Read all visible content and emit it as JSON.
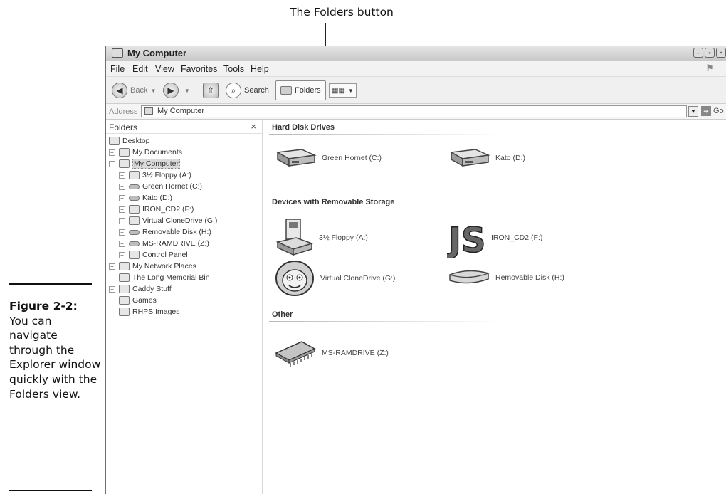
{
  "callout": {
    "text": "The Folders button"
  },
  "caption": {
    "label": "Figure 2-2:",
    "text": "You can navigate through the Explorer window quickly with the Folders view."
  },
  "window": {
    "title": "My Computer",
    "menu": [
      "File",
      "Edit",
      "View",
      "Favorites",
      "Tools",
      "Help"
    ],
    "toolbar": {
      "back_label": "Back",
      "search_label": "Search",
      "folders_label": "Folders"
    },
    "address": {
      "label": "Address",
      "value": "My Computer",
      "go_label": "Go"
    },
    "folders_pane": {
      "title": "Folders",
      "close": "×",
      "tree": [
        {
          "label": "Desktop",
          "icon": "desktop-icon"
        },
        {
          "label": "My Documents",
          "icon": "folder-icon"
        },
        {
          "label": "My Computer",
          "icon": "computer-icon",
          "selected": true
        },
        {
          "label": "3½ Floppy (A:)",
          "icon": "floppy-icon"
        },
        {
          "label": "Green Hornet (C:)",
          "icon": "drive-icon"
        },
        {
          "label": "Kato (D:)",
          "icon": "drive-icon"
        },
        {
          "label": "IRON_CD2 (F:)",
          "icon": "cd-drive-icon"
        },
        {
          "label": "Virtual CloneDrive (G:)",
          "icon": "virtual-drive-icon"
        },
        {
          "label": "Removable Disk (H:)",
          "icon": "removable-disk-icon"
        },
        {
          "label": "MS-RAMDRIVE (Z:)",
          "icon": "ram-drive-icon"
        },
        {
          "label": "Control Panel",
          "icon": "control-panel-icon"
        },
        {
          "label": "My Network Places",
          "icon": "network-icon"
        },
        {
          "label": "The Long Memorial Bin",
          "icon": "recycle-bin-icon"
        },
        {
          "label": "Caddy Stuff",
          "icon": "folder-icon"
        },
        {
          "label": "Games",
          "icon": "folder-icon"
        },
        {
          "label": "RHPS Images",
          "icon": "folder-icon"
        }
      ]
    },
    "content": {
      "groups": [
        {
          "title": "Hard Disk Drives",
          "items": [
            "Green Hornet (C:)",
            "Kato (D:)"
          ]
        },
        {
          "title": "Devices with Removable Storage",
          "items": [
            "3½ Floppy (A:)",
            "IRON_CD2 (F:)",
            "Virtual CloneDrive (G:)",
            "Removable Disk (H:)"
          ]
        },
        {
          "title": "Other",
          "items": [
            "MS-RAMDRIVE (Z:)"
          ]
        }
      ]
    }
  }
}
